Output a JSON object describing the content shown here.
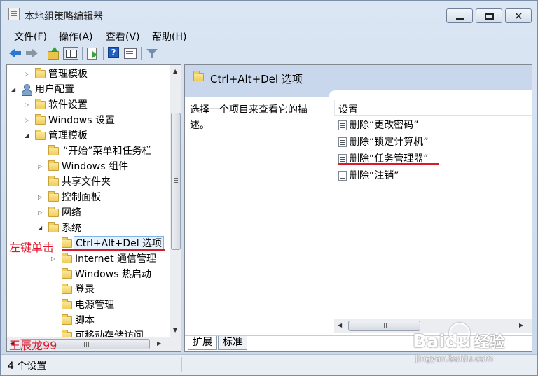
{
  "window": {
    "title": "本地组策略编辑器",
    "controls": {
      "minimize": "minimize-icon",
      "maximize": "maximize-icon",
      "close": "✕"
    }
  },
  "menu": [
    "文件(F)",
    "操作(A)",
    "查看(V)",
    "帮助(H)"
  ],
  "toolbar": {
    "icons": [
      "back-arrow-icon",
      "forward-arrow-icon",
      "up-folder-icon",
      "show-tree-icon",
      "export-list-icon",
      "help-icon",
      "properties-icon",
      "filter-icon"
    ],
    "help_glyph": "?"
  },
  "tree": {
    "items": [
      {
        "label": "管理模板",
        "expander": "▷"
      },
      {
        "label": "用户配置",
        "expander": "◢"
      },
      {
        "label": "软件设置",
        "expander": "▷"
      },
      {
        "label": "Windows 设置",
        "expander": "▷"
      },
      {
        "label": "管理模板",
        "expander": "◢"
      },
      {
        "label": "“开始”菜单和任务栏",
        "expander": ""
      },
      {
        "label": "Windows 组件",
        "expander": "▷"
      },
      {
        "label": "共享文件夹",
        "expander": ""
      },
      {
        "label": "控制面板",
        "expander": "▷"
      },
      {
        "label": "网络",
        "expander": "▷"
      },
      {
        "label": "系统",
        "expander": "◢"
      },
      {
        "label": "Ctrl+Alt+Del 选项",
        "expander": "",
        "selected": true
      },
      {
        "label": "Internet 通信管理",
        "expander": "▷"
      },
      {
        "label": "Windows 热启动",
        "expander": ""
      },
      {
        "label": "登录",
        "expander": ""
      },
      {
        "label": "电源管理",
        "expander": ""
      },
      {
        "label": "脚本",
        "expander": ""
      },
      {
        "label": "可移动存储访问",
        "expander": ""
      }
    ],
    "scroll_up": "▲",
    "scroll_down": "▼",
    "scroll_left": "◀",
    "scroll_right": "▶"
  },
  "details": {
    "header_title": "Ctrl+Alt+Del 选项",
    "description": "选择一个项目来查看它的描述。",
    "column_header": "设置",
    "settings": [
      "删除“更改密码”",
      "删除“锁定计算机”",
      "删除“任务管理器”",
      "删除“注销”"
    ],
    "scroll_left": "◀",
    "scroll_right": "▶",
    "tabs": [
      "扩展",
      "标准"
    ]
  },
  "status": {
    "text": "4 个设置"
  },
  "annotations": {
    "left_click_note": "左键单击",
    "author_note": "王辰龙99",
    "accent_color": "#e0152a"
  },
  "watermark": {
    "logo_text": "Baidu",
    "logo_suffix": "经验",
    "url": "jingyan.baidu.com"
  }
}
